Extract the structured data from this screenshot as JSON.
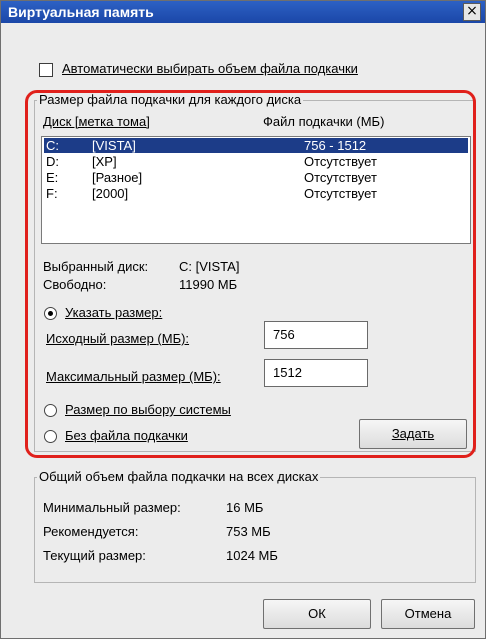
{
  "window": {
    "title": "Виртуальная память",
    "close_glyph": "×"
  },
  "auto_checkbox": {
    "label": "Автоматически выбирать объем файла подкачки",
    "checked": false
  },
  "per_disk": {
    "group_title": "Размер файла подкачки для каждого диска",
    "col_disk": "Диск [метка тома]",
    "col_file": "Файл подкачки (МБ)",
    "rows": [
      {
        "drive": "C:",
        "label": "[VISTA]",
        "size": "756 - 1512",
        "selected": true
      },
      {
        "drive": "D:",
        "label": "[XP]",
        "size": "Отсутствует",
        "selected": false
      },
      {
        "drive": "E:",
        "label": "[Разное]",
        "size": "Отсутствует",
        "selected": false
      },
      {
        "drive": "F:",
        "label": "[2000]",
        "size": "Отсутствует",
        "selected": false
      }
    ],
    "selected_disk_label": "Выбранный диск:",
    "selected_disk_value": "C:  [VISTA]",
    "free_label": "Свободно:",
    "free_value": "11990 МБ",
    "radio_custom": "Указать размер:",
    "initial_label": "Исходный размер (МБ):",
    "initial_value": "756",
    "max_label": "Максимальный размер (МБ):",
    "max_value": "1512",
    "radio_system": "Размер по выбору системы",
    "radio_none": "Без файла подкачки",
    "set_button": "Задать",
    "highlight_color": "#e0201b"
  },
  "total": {
    "group_title": "Общий объем файла подкачки на всех дисках",
    "min_label": "Минимальный размер:",
    "min_value": "16 МБ",
    "rec_label": "Рекомендуется:",
    "rec_value": "753 МБ",
    "cur_label": "Текущий размер:",
    "cur_value": "1024 МБ"
  },
  "buttons": {
    "ok": "ОК",
    "cancel": "Отмена"
  }
}
